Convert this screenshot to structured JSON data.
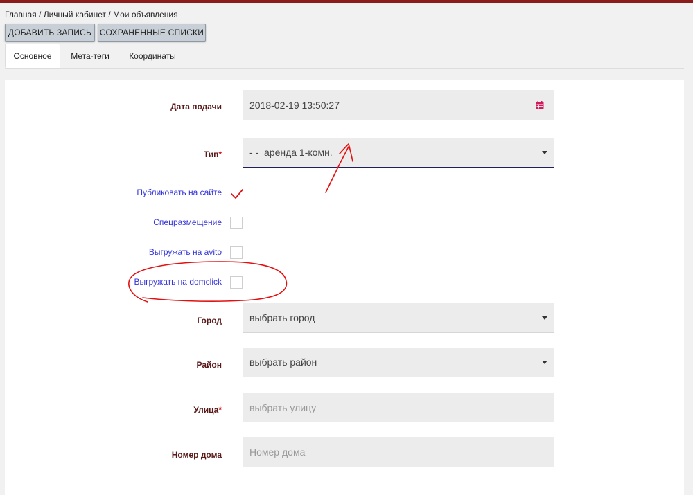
{
  "breadcrumb": {
    "home": "Главная",
    "sep1": " / ",
    "cabinet": "Личный кабинет",
    "sep2": " / ",
    "current": "Мои объявления"
  },
  "toolbar": {
    "add_label": "ДОБАВИТЬ ЗАПИСЬ",
    "saved_label": "СОХРАНЕННЫЕ СПИСКИ"
  },
  "tabs": [
    {
      "label": "Основное",
      "active": true
    },
    {
      "label": "Мета-теги",
      "active": false
    },
    {
      "label": "Координаты",
      "active": false
    }
  ],
  "form": {
    "date": {
      "label": "Дата подачи",
      "value": "2018-02-19 13:50:27"
    },
    "type": {
      "label": "Тип",
      "required_mark": "*",
      "value": "- -  аренда 1-комн."
    },
    "publish": {
      "label": "Публиковать на сайте",
      "checked": true
    },
    "special": {
      "label": "Спецразмещение",
      "checked": false
    },
    "avito": {
      "label": "Выгружать на avito",
      "checked": false
    },
    "domclick": {
      "label": "Выгружать на domclick",
      "checked": false
    },
    "city": {
      "label": "Город",
      "value": "выбрать город"
    },
    "district": {
      "label": "Район",
      "value": "выбрать район"
    },
    "street": {
      "label": "Улица",
      "required_mark": "*",
      "placeholder": "выбрать улицу"
    },
    "house": {
      "label": "Номер дома",
      "placeholder": "Номер дома"
    }
  },
  "colors": {
    "topbar": "#8c1c1c",
    "label_dark": "#5a1a1a",
    "label_blue": "#3535d8",
    "required": "#d11111",
    "calendar_icon": "#d11a5c",
    "annotation": "#e31010",
    "focus_underline": "#1f1f5c"
  },
  "icons": {
    "date": "calendar-icon",
    "dropdown": "caret-down-icon",
    "checked": "checkmark-icon"
  }
}
